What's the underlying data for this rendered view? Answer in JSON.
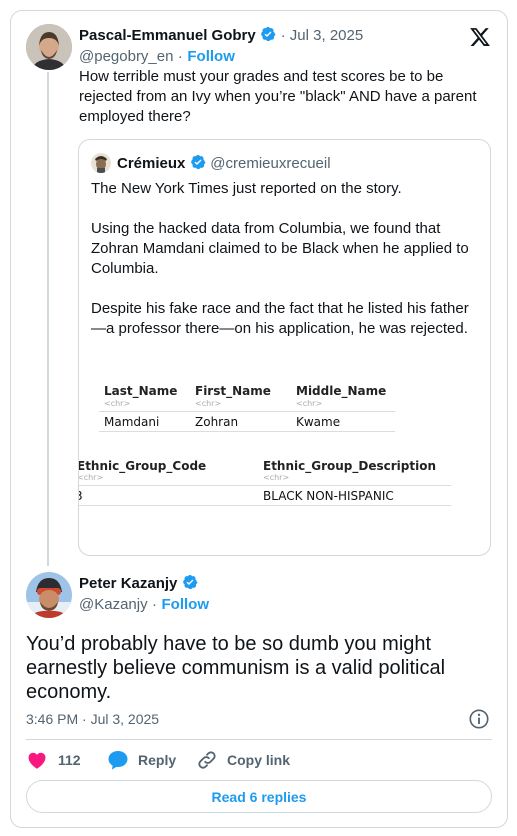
{
  "parent_tweet": {
    "author_name": "Pascal-Emmanuel Gobry",
    "date": "· Jul 3, 2025",
    "handle": "@pegobry_en",
    "separator": "·",
    "follow_label": "Follow",
    "text": "How terrible must your grades and test scores be to be rejected from an Ivy when you’re \"black\" AND have a parent employed there?"
  },
  "quoted_tweet": {
    "author_name": "Crémieux",
    "handle": "@cremieuxrecueil",
    "paragraphs": [
      "The New York Times just reported on the story.",
      "Using the hacked data from Columbia, we found that Zohran Mamdani claimed to be Black when he applied to Columbia.",
      "Despite his fake race and the fact that he listed his father —a professor there—on his application, he was rejected."
    ],
    "table1": {
      "headers": [
        "Last_Name",
        "First_Name",
        "Middle_Name"
      ],
      "types": [
        "<chr>",
        "<chr>",
        "<chr>"
      ],
      "values": [
        "Mamdani",
        "Zohran",
        "Kwame"
      ]
    },
    "table2": {
      "headers": [
        "Ethnic_Group_Code",
        "Ethnic_Group_Description"
      ],
      "types": [
        "<chr>",
        "<chr>"
      ],
      "values": [
        "3",
        "BLACK NON-HISPANIC"
      ]
    }
  },
  "reply_tweet": {
    "author_name": "Peter Kazanjy",
    "handle": "@Kazanjy",
    "separator": "·",
    "follow_label": "Follow",
    "text": "You’d probably have to be so dumb you might earnestly believe communism is a valid political economy.",
    "timestamp": "3:46 PM · Jul 3, 2025"
  },
  "actions": {
    "like_count": "112",
    "reply_label": "Reply",
    "copy_link_label": "Copy link"
  },
  "read_replies_label": "Read 6 replies",
  "colors": {
    "accent": "#1d9bf0",
    "like": "#f91880",
    "muted": "#536471",
    "border": "#cfd9de"
  }
}
